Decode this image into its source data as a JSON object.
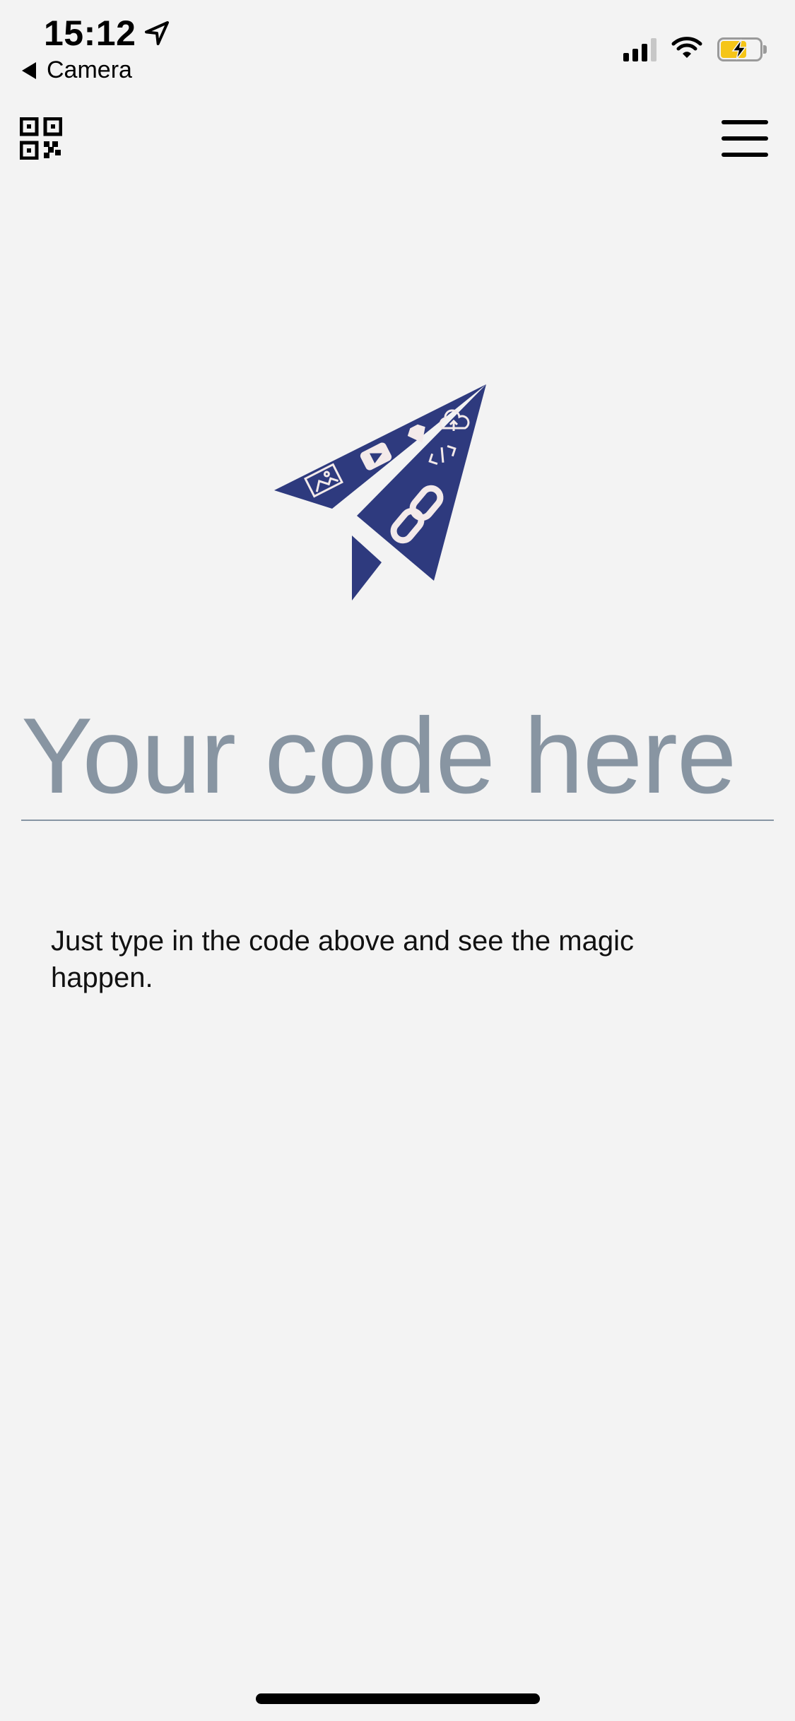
{
  "status_bar": {
    "time": "15:12",
    "back_app": "Camera",
    "icons": [
      "location-arrow-icon",
      "signal-icon",
      "wifi-icon",
      "battery-charging-icon"
    ]
  },
  "nav": {
    "left_icon": "qr-code-icon",
    "right_icon": "hamburger-menu-icon"
  },
  "logo": {
    "icon": "paper-plane-logo",
    "color": "#2e3a7e"
  },
  "code_input": {
    "placeholder": "Your code here",
    "value": ""
  },
  "hint": {
    "text": "Just type in the code above and see the magic happen."
  },
  "colors": {
    "background": "#f3f3f3",
    "placeholder": "#8895a2",
    "underline": "#8795a4",
    "battery": "#f5c518"
  }
}
